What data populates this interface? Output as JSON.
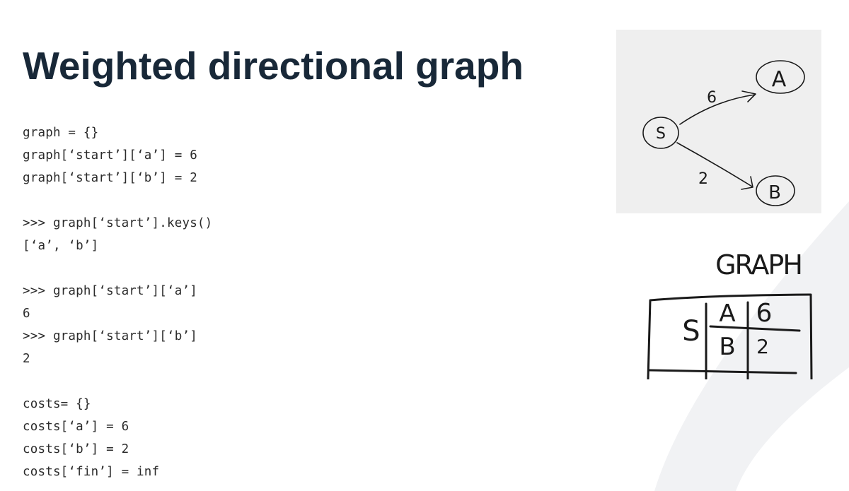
{
  "slide": {
    "title": "Weighted directional graph"
  },
  "code": {
    "lines": [
      "graph = {}",
      "graph[‘start’][‘a’] = 6",
      "graph[‘start’][‘b’] = 2",
      "",
      ">>> graph[‘start’].keys()",
      "[‘a’, ‘b’]",
      "",
      ">>> graph[‘start’][‘a’]",
      "6",
      ">>> graph[‘start’][‘b’]",
      "2",
      "",
      "costs= {}",
      "costs[‘a’] = 6",
      "costs[‘b’] = 2",
      "costs[‘fin’] = inf"
    ]
  },
  "sketch_graph": {
    "nodes": [
      "S",
      "A",
      "B"
    ],
    "edges": [
      {
        "from": "S",
        "to": "A",
        "weight": "6"
      },
      {
        "from": "S",
        "to": "B",
        "weight": "2"
      }
    ]
  },
  "sketch_table": {
    "heading": "GRAPH",
    "row_label": "S",
    "rows": [
      {
        "node": "A",
        "weight": "6"
      },
      {
        "node": "B",
        "weight": "2"
      }
    ]
  },
  "colors": {
    "title": "#182838",
    "code": "#2b2b2b",
    "sketch_bg": "#efefef",
    "ink": "#1a1a1a",
    "arc": "#f1f2f4"
  }
}
